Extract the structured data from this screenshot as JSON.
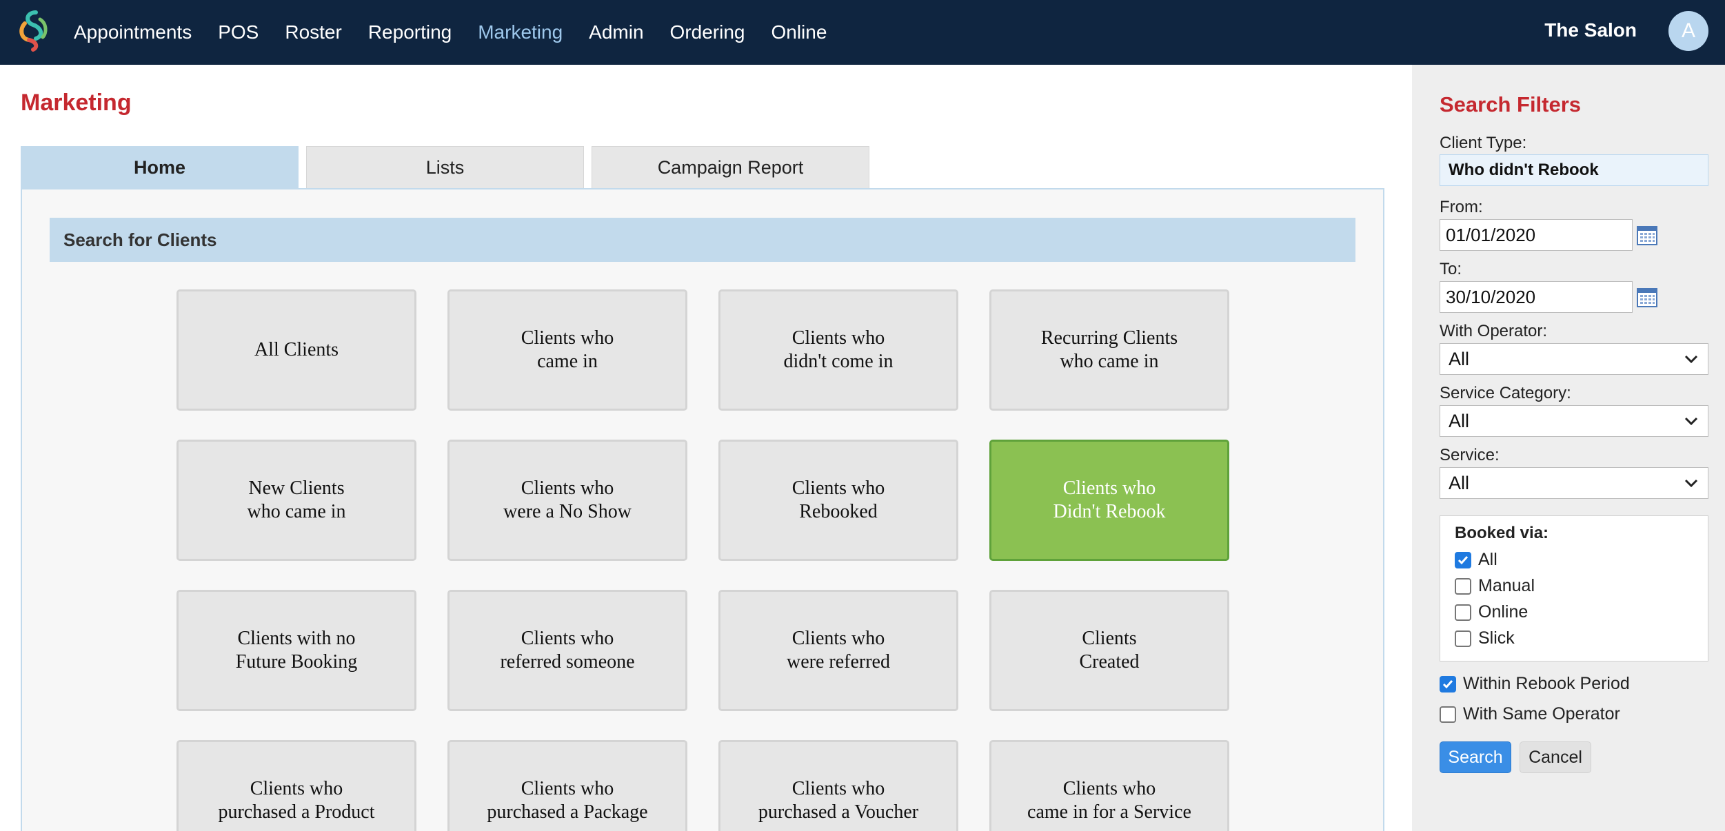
{
  "nav": {
    "items": [
      "Appointments",
      "POS",
      "Roster",
      "Reporting",
      "Marketing",
      "Admin",
      "Ordering",
      "Online"
    ],
    "active": "Marketing",
    "salon_name": "The Salon",
    "avatar_letter": "A"
  },
  "page": {
    "title": "Marketing",
    "tabs": [
      {
        "label": "Home",
        "active": true
      },
      {
        "label": "Lists",
        "active": false
      },
      {
        "label": "Campaign Report",
        "active": false
      }
    ],
    "section_title": "Search for Clients",
    "tiles": [
      {
        "label": "All Clients",
        "selected": false
      },
      {
        "label": "Clients who\ncame in",
        "selected": false
      },
      {
        "label": "Clients who\ndidn't come in",
        "selected": false
      },
      {
        "label": "Recurring Clients\nwho came in",
        "selected": false
      },
      {
        "label": "New Clients\nwho came in",
        "selected": false
      },
      {
        "label": "Clients who\nwere a No Show",
        "selected": false
      },
      {
        "label": "Clients who\nRebooked",
        "selected": false
      },
      {
        "label": "Clients who\nDidn't Rebook",
        "selected": true
      },
      {
        "label": "Clients with no\nFuture Booking",
        "selected": false
      },
      {
        "label": "Clients who\nreferred someone",
        "selected": false
      },
      {
        "label": "Clients who\nwere referred",
        "selected": false
      },
      {
        "label": "Clients\nCreated",
        "selected": false
      },
      {
        "label": "Clients who\npurchased a Product",
        "selected": false
      },
      {
        "label": "Clients who\npurchased a Package",
        "selected": false
      },
      {
        "label": "Clients who\npurchased a Voucher",
        "selected": false
      },
      {
        "label": "Clients who\ncame in for a Service",
        "selected": false
      }
    ]
  },
  "filters": {
    "title": "Search Filters",
    "client_type_label": "Client Type:",
    "client_type_value": "Who didn't Rebook",
    "from_label": "From:",
    "from_value": "01/01/2020",
    "to_label": "To:",
    "to_value": "30/10/2020",
    "operator_label": "With Operator:",
    "operator_value": "All",
    "service_category_label": "Service Category:",
    "service_category_value": "All",
    "service_label": "Service:",
    "service_value": "All",
    "booked_via_title": "Booked via:",
    "booked_via": [
      {
        "label": "All",
        "checked": true
      },
      {
        "label": "Manual",
        "checked": false
      },
      {
        "label": "Online",
        "checked": false
      },
      {
        "label": "Slick",
        "checked": false
      }
    ],
    "within_rebook_label": "Within Rebook Period",
    "within_rebook_checked": true,
    "same_operator_label": "With Same Operator",
    "same_operator_checked": false,
    "search_button": "Search",
    "cancel_button": "Cancel"
  },
  "colors": {
    "topbar": "#0f2540",
    "nav_active": "#9ec8ec",
    "title_red": "#c5282f",
    "tab_active": "#c2daec",
    "tile_selected": "#8bc152",
    "search_button": "#3a8ee6"
  },
  "icons": {
    "logo": "salon-logo-icon",
    "calendar": "calendar-icon",
    "dropdown": "chevron-down-icon",
    "checkbox": "checkmark-icon"
  }
}
